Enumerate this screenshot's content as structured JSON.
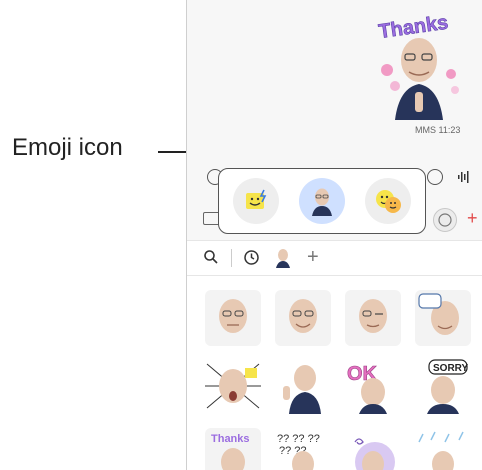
{
  "callout": {
    "label": "Emoji icon"
  },
  "message": {
    "timestamp": "MMS 11:23",
    "sticker_text": "Thanks"
  },
  "icons": {
    "emoji": "emoji-sticker-icon",
    "avatar": "avatar-emoji-icon",
    "bitmoji": "face-emoji-icon",
    "search": "search-icon",
    "recent": "clock-icon",
    "add": "plus-icon",
    "voice": "voice-waveform-icon",
    "keyboard": "keyboard-icon"
  },
  "stickers": {
    "row1": [
      "avatar-neutral",
      "avatar-smile",
      "avatar-wink",
      "avatar-cool"
    ],
    "row2": [
      "avatar-shock",
      "avatar-wave",
      "avatar-ok",
      "avatar-sorry"
    ],
    "row3": [
      "avatar-thanks",
      "avatar-confused",
      "avatar-dizzy",
      "avatar-rain"
    ],
    "sorry_text": "SORRY",
    "ok_text": "OK"
  },
  "colors": {
    "accent_red": "#e24a4a",
    "selected_blue": "#cfe0ff",
    "emoji_yellow": "#f6e44a"
  }
}
